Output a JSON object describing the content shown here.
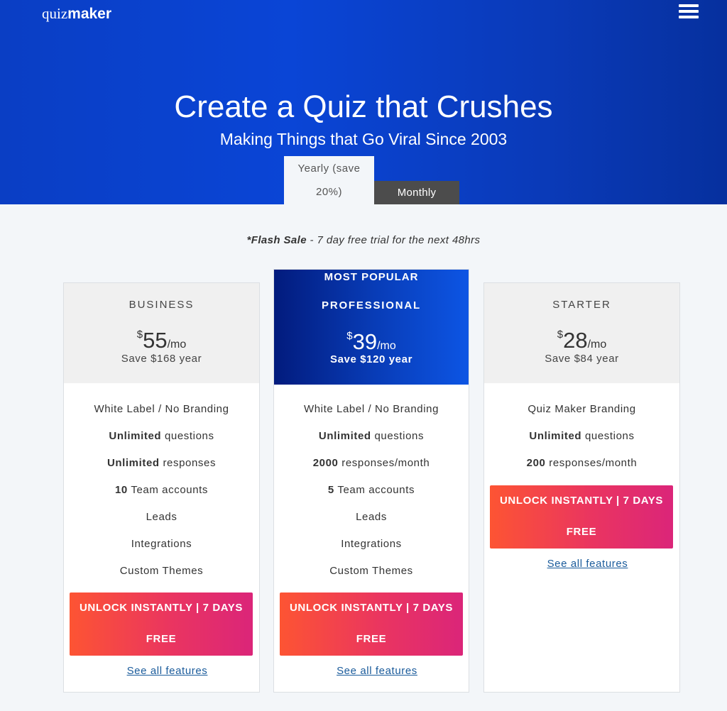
{
  "header": {
    "logo_light": "quiz",
    "logo_bold": "maker",
    "menu_icon": "hamburger-menu-icon"
  },
  "hero": {
    "title": "Create a Quiz that Crushes",
    "subtitle": "Making Things that Go Viral Since 2003"
  },
  "billing_tabs": {
    "yearly_line1": "Yearly (save",
    "yearly_line2": "20%)",
    "monthly": "Monthly",
    "selected": "Yearly (save 20%)"
  },
  "flash_sale": {
    "bold": "*Flash Sale",
    "rest": " - 7 day free trial for the next 48hrs"
  },
  "plans": {
    "business": {
      "name": "BUSINESS",
      "currency": "$",
      "price": "55",
      "period": "/mo",
      "save": "Save $168 year",
      "features": [
        {
          "bold": "",
          "text": "White Label / No Branding"
        },
        {
          "bold": "Unlimited",
          "text": " questions"
        },
        {
          "bold": "Unlimited",
          "text": " responses"
        },
        {
          "bold": "10",
          "text": " Team accounts"
        },
        {
          "bold": "",
          "text": "Leads"
        },
        {
          "bold": "",
          "text": "Integrations"
        },
        {
          "bold": "",
          "text": "Custom Themes"
        }
      ],
      "cta_line1": "UNLOCK INSTANTLY | 7 DAYS",
      "cta_line2": "FREE",
      "see_all": "See all features"
    },
    "professional": {
      "badge": "MOST POPULAR",
      "name": "PROFESSIONAL",
      "currency": "$",
      "price": "39",
      "period": "/mo",
      "save": "Save $120 year",
      "features": [
        {
          "bold": "",
          "text": "White Label / No Branding"
        },
        {
          "bold": "Unlimited",
          "text": " questions"
        },
        {
          "bold": "2000",
          "text": " responses/month"
        },
        {
          "bold": "5",
          "text": " Team accounts"
        },
        {
          "bold": "",
          "text": "Leads"
        },
        {
          "bold": "",
          "text": "Integrations"
        },
        {
          "bold": "",
          "text": "Custom Themes"
        }
      ],
      "cta_line1": "UNLOCK INSTANTLY | 7 DAYS",
      "cta_line2": "FREE",
      "see_all": "See all features"
    },
    "starter": {
      "name": "STARTER",
      "currency": "$",
      "price": "28",
      "period": "/mo",
      "save": "Save $84 year",
      "features": [
        {
          "bold": "",
          "text": "Quiz Maker Branding"
        },
        {
          "bold": "Unlimited",
          "text": " questions"
        },
        {
          "bold": "200",
          "text": " responses/month"
        }
      ],
      "cta_line1": "UNLOCK INSTANTLY | 7 DAYS",
      "cta_line2": "FREE",
      "see_all": "See all features"
    }
  },
  "colors": {
    "hero_blue": "#0a45d6",
    "pro_gradient_start": "#021b7d",
    "pro_gradient_end": "#0d55e4",
    "cta_gradient_start": "#fd5433",
    "cta_gradient_end": "#db2579",
    "monthly_tab": "#4c4c4c",
    "link": "#1a5b9b"
  }
}
